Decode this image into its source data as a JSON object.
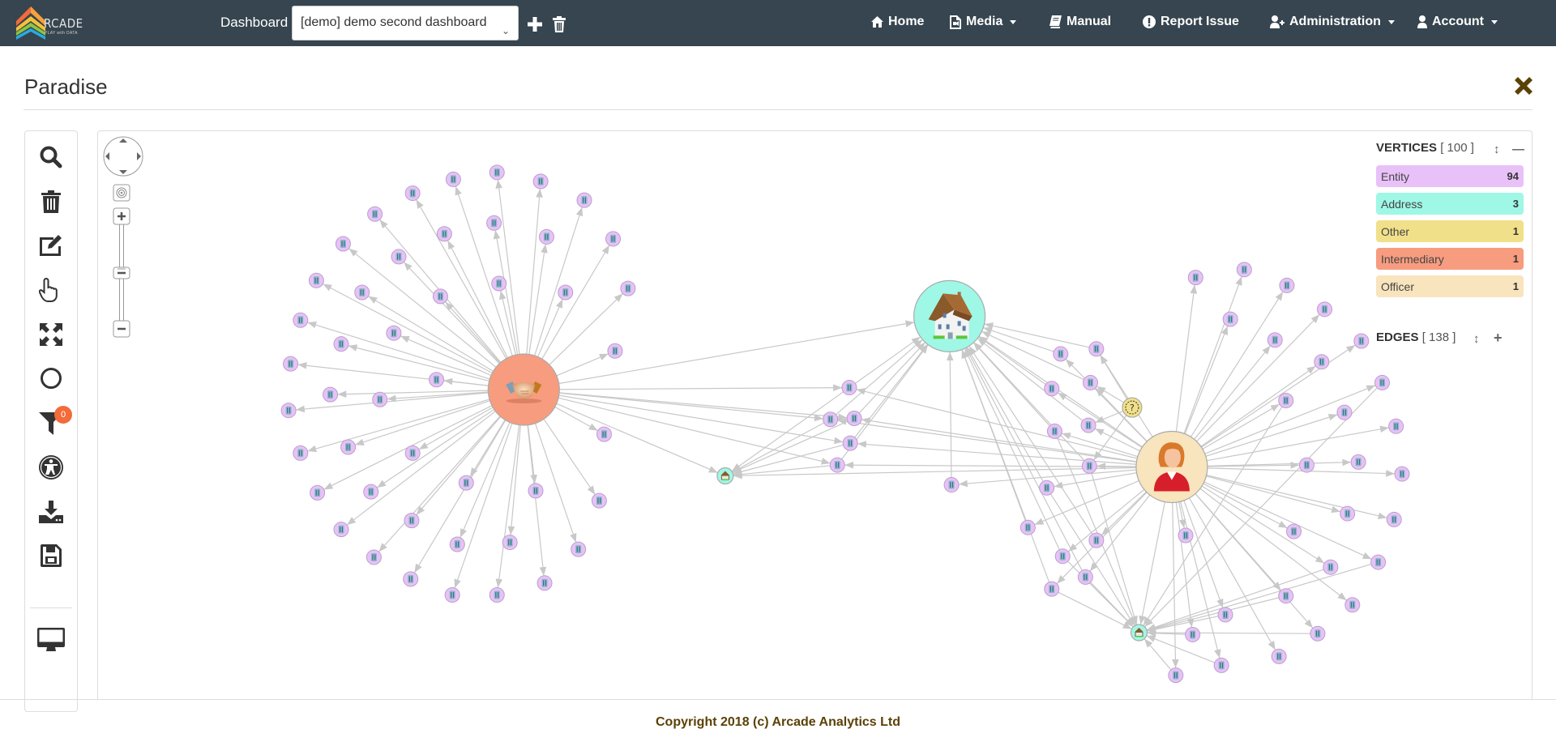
{
  "app": {
    "logo_text": "RCADE",
    "logo_tagline": "PLAY with DATA",
    "dashboard_label": "Dashboard",
    "dashboard_selected": "[demo] demo second dashboard"
  },
  "nav": {
    "items": [
      {
        "label": "Home",
        "icon": "home-icon",
        "dropdown": false
      },
      {
        "label": "Media",
        "icon": "media-file-icon",
        "dropdown": true
      },
      {
        "label": "Manual",
        "icon": "book-icon",
        "dropdown": false
      },
      {
        "label": "Report Issue",
        "icon": "exclamation-circle-icon",
        "dropdown": false
      },
      {
        "label": "Administration",
        "icon": "user-plus-icon",
        "dropdown": true
      },
      {
        "label": "Account",
        "icon": "user-icon",
        "dropdown": true
      }
    ]
  },
  "widget": {
    "title": "Paradise"
  },
  "toolbar": {
    "tools": [
      {
        "name": "search",
        "icon": "search-icon"
      },
      {
        "name": "delete",
        "icon": "trash-icon"
      },
      {
        "name": "edit",
        "icon": "edit-icon"
      },
      {
        "name": "select",
        "icon": "hand-pointer-icon"
      },
      {
        "name": "expand",
        "icon": "expand-arrows-icon"
      },
      {
        "name": "circle-layout",
        "icon": "circle-icon"
      },
      {
        "name": "filter",
        "icon": "filter-icon",
        "badge": "0"
      },
      {
        "name": "accessibility",
        "icon": "accessibility-icon"
      },
      {
        "name": "download",
        "icon": "download-icon"
      },
      {
        "name": "save",
        "icon": "save-icon"
      },
      {
        "name": "fullscreen",
        "icon": "monitor-icon"
      }
    ]
  },
  "legend": {
    "vertices_label": "VERTICES",
    "vertices_count": "[ 100 ]",
    "edges_label": "EDGES",
    "edges_count": "[ 138 ]",
    "classes": [
      {
        "label": "Entity",
        "count": "94",
        "color": "#e8c1f8"
      },
      {
        "label": "Address",
        "count": "3",
        "color": "#9ff7e6"
      },
      {
        "label": "Other",
        "count": "1",
        "color": "#f1e08a"
      },
      {
        "label": "Intermediary",
        "count": "1",
        "color": "#f79c7f"
      },
      {
        "label": "Officer",
        "count": "1",
        "color": "#f8e4bd"
      }
    ]
  },
  "graph": {
    "hubs": [
      {
        "id": "intermediary",
        "class": "Intermediary",
        "icon": "handshake-icon"
      },
      {
        "id": "address-main",
        "class": "Address",
        "icon": "house-icon"
      },
      {
        "id": "officer",
        "class": "Officer",
        "icon": "person-icon"
      },
      {
        "id": "other",
        "class": "Other",
        "icon": "question-icon"
      },
      {
        "id": "address-left",
        "class": "Address",
        "icon": "house-icon"
      },
      {
        "id": "address-bottom",
        "class": "Address",
        "icon": "house-icon"
      }
    ],
    "entity_count": 94
  },
  "footer": {
    "copyright": "Copyright 2018 (c) Arcade Analytics Ltd"
  },
  "colors": {
    "navbar": "#36454f",
    "brand_brown": "#5b4106",
    "badge": "#f26b3a",
    "edge": "#c8c8c8"
  }
}
